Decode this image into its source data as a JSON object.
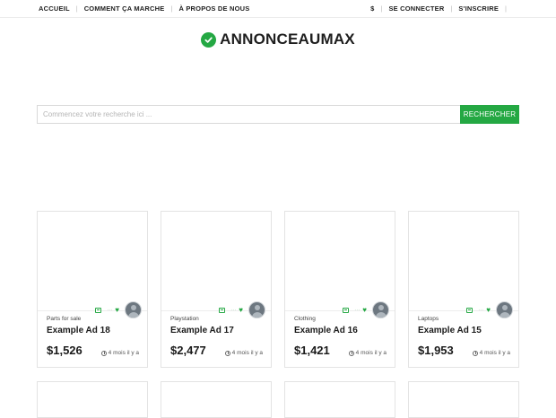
{
  "nav": {
    "home": "ACCUEIL",
    "how_it_works": "COMMENT ÇA MARCHE",
    "about": "À PROPOS DE NOUS",
    "currency": "$",
    "login": "SE CONNECTER",
    "register": "S'INSCRIRE"
  },
  "logo": {
    "text": "ANNONCEAUMAX",
    "icon": "check-badge-icon"
  },
  "search": {
    "placeholder": "Commencez votre recherche ici ...",
    "button_label": "RECHERCHER"
  },
  "theme": {
    "accent": "#24a843"
  },
  "ads": [
    {
      "category": "Parts for sale",
      "title": "Example Ad 18",
      "price": "$1,526",
      "posted": "4 mois il y a"
    },
    {
      "category": "Playstation",
      "title": "Example Ad 17",
      "price": "$2,477",
      "posted": "4 mois il y a"
    },
    {
      "category": "Clothing",
      "title": "Example Ad 16",
      "price": "$1,421",
      "posted": "4 mois il y a"
    },
    {
      "category": "Laptops",
      "title": "Example Ad 15",
      "price": "$1,953",
      "posted": "4 mois il y a"
    }
  ]
}
